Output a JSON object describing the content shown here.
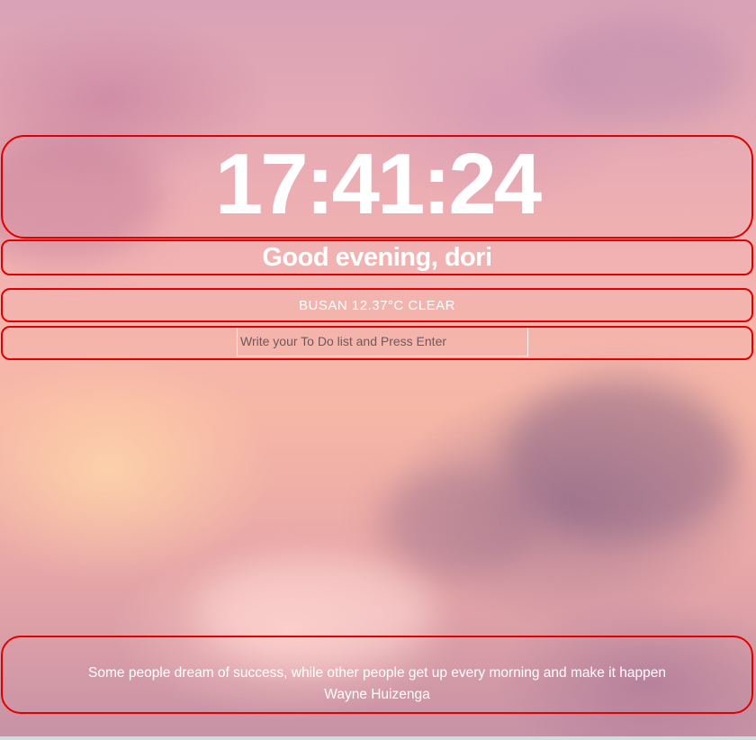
{
  "clock": {
    "time": "17:41:24"
  },
  "greeting": {
    "text": "Good evening, dori"
  },
  "weather": {
    "text": "BUSAN 12.37°C CLEAR"
  },
  "todo": {
    "placeholder": "Write your To Do list and Press Enter",
    "value": ""
  },
  "quote": {
    "text": "Some people dream of success, while other people get up every morning and make it happen",
    "author": "Wayne Huizenga"
  },
  "colors": {
    "outline": "#e00000",
    "text": "#ffffff",
    "sky_pink": "#f2b2b2",
    "sky_mauve": "#c792a6"
  }
}
